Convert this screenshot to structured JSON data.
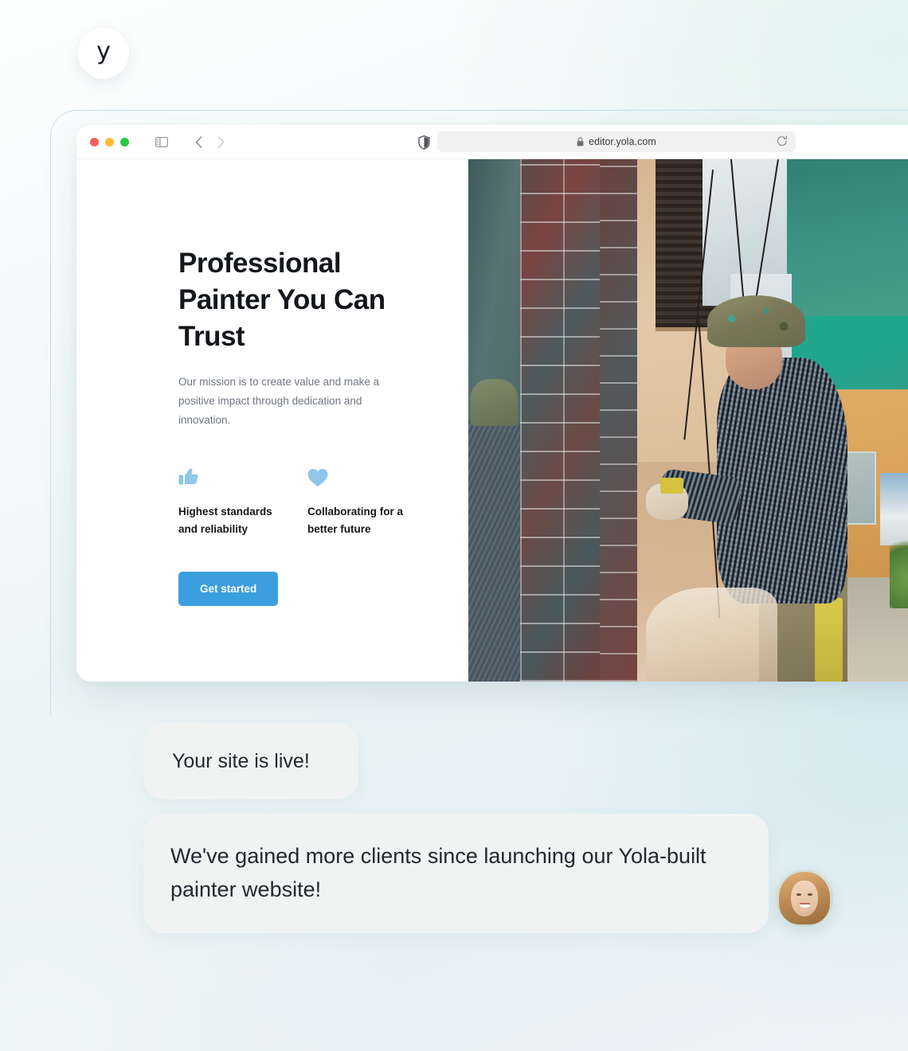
{
  "browser": {
    "window_controls": [
      "close",
      "minimize",
      "maximize"
    ],
    "sidebar_toggle_icon": "sidebar-toggle-icon",
    "back_icon": "chevron-left-icon",
    "forward_icon": "chevron-right-icon",
    "shield_icon": "shield-icon",
    "lock_icon": "lock-icon",
    "reload_icon": "reload-icon",
    "url": "editor.yola.com"
  },
  "site": {
    "hero": {
      "title": "Professional Painter You Can Trust",
      "subtitle": "Our mission is to create value and make a positive impact through dedication and innovation.",
      "cta_label": "Get started",
      "cta_color": "#3b9ede"
    },
    "features": [
      {
        "icon": "thumbs-up-icon",
        "label": "Highest standards and reliability",
        "icon_color": "#8fc6ea"
      },
      {
        "icon": "heart-icon",
        "label": "Collaborating for a better future",
        "icon_color": "#8fc6ea"
      }
    ],
    "photo_alt": "Painter in camouflage bucket hat painting an exterior wall in an alley"
  },
  "chat": {
    "brand_avatar_letter": "y",
    "messages": [
      {
        "text": "Your site is live!",
        "sender": "yola"
      },
      {
        "text": "We've gained more clients since launching our Yola-built painter website!",
        "sender": "customer"
      }
    ]
  }
}
